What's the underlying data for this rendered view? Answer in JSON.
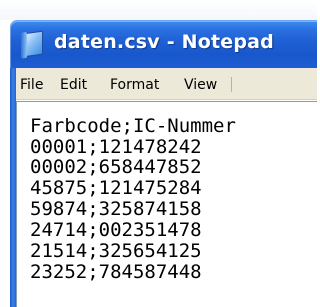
{
  "window": {
    "title": "daten.csv - Notepad"
  },
  "menu": {
    "file": "File",
    "edit": "Edit",
    "format": "Format",
    "view": "View"
  },
  "editor": {
    "lines": [
      "Farbcode;IC-Nummer",
      "00001;121478242",
      "00002;658447852",
      "45875;121475284",
      "59874;325874158",
      "24714;002351478",
      "21514;325654125",
      "23252;784587448"
    ]
  },
  "icons": {
    "app": "notepad-icon"
  },
  "colors": {
    "titlebar": "#1e5fd4",
    "menubar": "#ece9d8",
    "editor_background": "#ffffff"
  }
}
